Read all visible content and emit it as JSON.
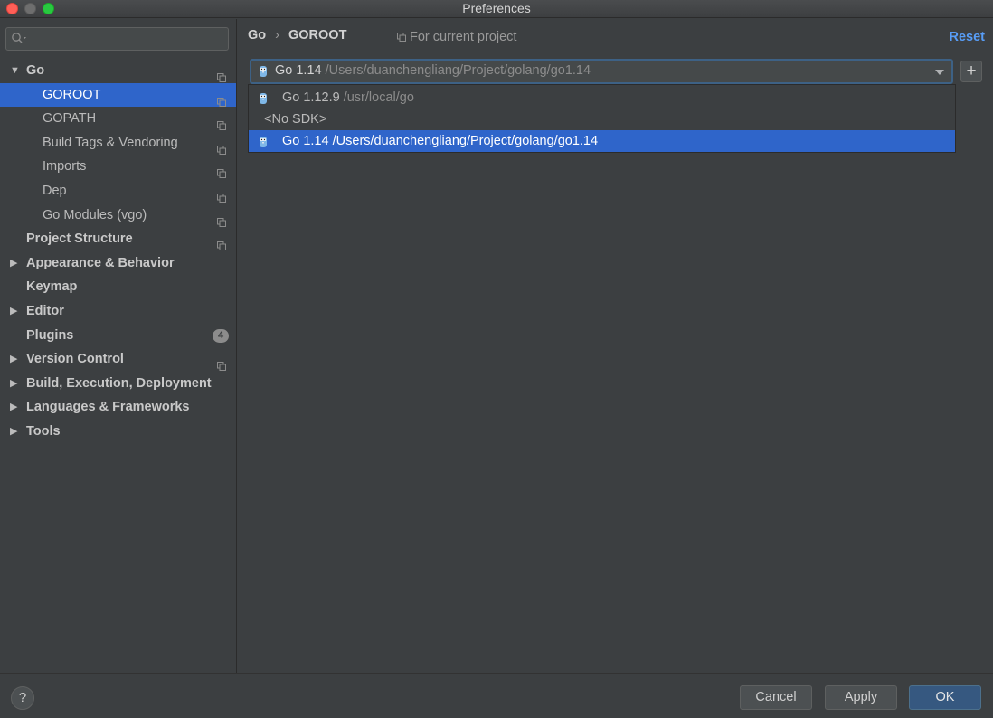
{
  "window": {
    "title": "Preferences"
  },
  "search": {
    "placeholder": "",
    "value": ""
  },
  "sidebar": {
    "items": [
      {
        "label": "Go",
        "level": 0,
        "arrow": "▼",
        "copy_icon": true
      },
      {
        "label": "GOROOT",
        "level": 1,
        "selected": true,
        "copy_icon": true
      },
      {
        "label": "GOPATH",
        "level": 1,
        "copy_icon": true
      },
      {
        "label": "Build Tags & Vendoring",
        "level": 1,
        "copy_icon": true
      },
      {
        "label": "Imports",
        "level": 1,
        "copy_icon": true
      },
      {
        "label": "Dep",
        "level": 1,
        "copy_icon": true
      },
      {
        "label": "Go Modules (vgo)",
        "level": 1,
        "copy_icon": true
      },
      {
        "label": "Project Structure",
        "level": 0,
        "copy_icon": true
      },
      {
        "label": "Appearance & Behavior",
        "level": 0,
        "arrow": "▶"
      },
      {
        "label": "Keymap",
        "level": 0
      },
      {
        "label": "Editor",
        "level": 0,
        "arrow": "▶"
      },
      {
        "label": "Plugins",
        "level": 0,
        "badge": "4"
      },
      {
        "label": "Version Control",
        "level": 0,
        "arrow": "▶",
        "copy_icon": true
      },
      {
        "label": "Build, Execution, Deployment",
        "level": 0,
        "arrow": "▶"
      },
      {
        "label": "Languages & Frameworks",
        "level": 0,
        "arrow": "▶"
      },
      {
        "label": "Tools",
        "level": 0,
        "arrow": "▶"
      }
    ]
  },
  "header": {
    "breadcrumb_parent": "Go",
    "breadcrumb_separator": "›",
    "breadcrumb_current": "GOROOT",
    "scope_label": "For current project",
    "reset_label": "Reset"
  },
  "sdk": {
    "selected_name": "Go 1.14",
    "selected_path": "/Users/duanchengliang/Project/golang/go1.14",
    "add_label": "+",
    "options": [
      {
        "name": "Go 1.12.9",
        "path": "/usr/local/go",
        "icon": "gopher-icon"
      },
      {
        "name": "<No SDK>",
        "path": "",
        "icon": null
      },
      {
        "name": "Go 1.14",
        "path": "/Users/duanchengliang/Project/golang/go1.14",
        "icon": "gopher-icon",
        "selected": true
      }
    ]
  },
  "footer": {
    "help_label": "?",
    "cancel_label": "Cancel",
    "apply_label": "Apply",
    "ok_label": "OK"
  },
  "colors": {
    "background": "#3c3f41",
    "selection": "#2f65ca",
    "link": "#589df6",
    "ok_button": "#365880"
  }
}
